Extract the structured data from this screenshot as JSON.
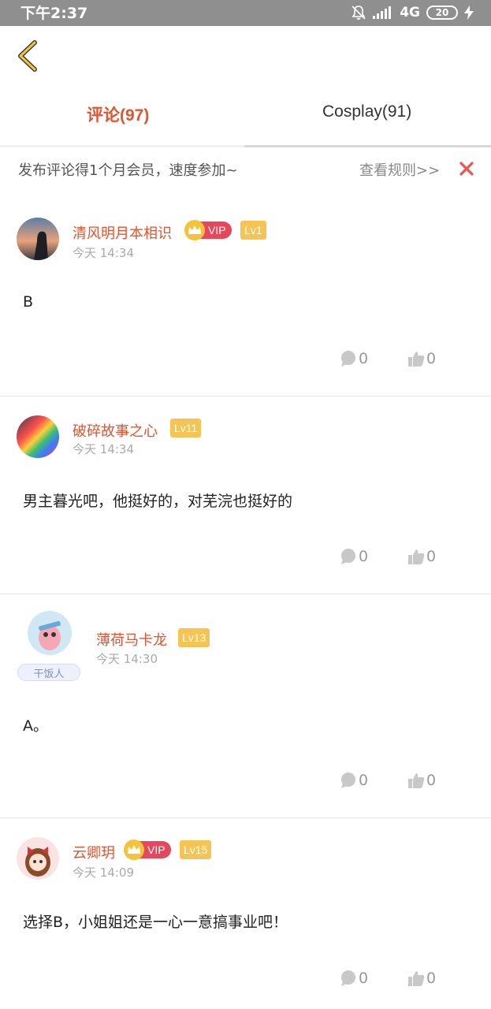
{
  "status_bar": {
    "time": "下午2:37",
    "network": "4G",
    "battery": "20"
  },
  "tabs": [
    {
      "label": "评论(97)"
    },
    {
      "label": "Cosplay(91)"
    }
  ],
  "notice": {
    "text": "发布评论得1个月会员，速度参加~",
    "rules_link": "查看规则>>"
  },
  "vip_label": "VIP",
  "colors": {
    "accent": "#e0542f",
    "vip": "#e8465a",
    "level": "#f5c453",
    "crown": "#f4c339"
  },
  "comments": [
    {
      "username": "清风明月本相识",
      "vip": true,
      "level": "Lv1",
      "time": "今天 14:34",
      "text": "B",
      "reply_count": "0",
      "like_count": "0"
    },
    {
      "username": "破碎故事之心",
      "vip": false,
      "level": "Lv11",
      "time": "今天 14:34",
      "text": "男主暮光吧，他挺好的，对芜浣也挺好的",
      "reply_count": "0",
      "like_count": "0"
    },
    {
      "username": "薄荷马卡龙",
      "vip": false,
      "level": "Lv13",
      "badge": "干饭人",
      "time": "今天 14:30",
      "text": "A。",
      "reply_count": "0",
      "like_count": "0"
    },
    {
      "username": "云卿玥",
      "vip": true,
      "level": "Lv15",
      "time": "今天 14:09",
      "text": "选择B，小姐姐还是一心一意搞事业吧！",
      "reply_count": "0",
      "like_count": "0"
    }
  ]
}
